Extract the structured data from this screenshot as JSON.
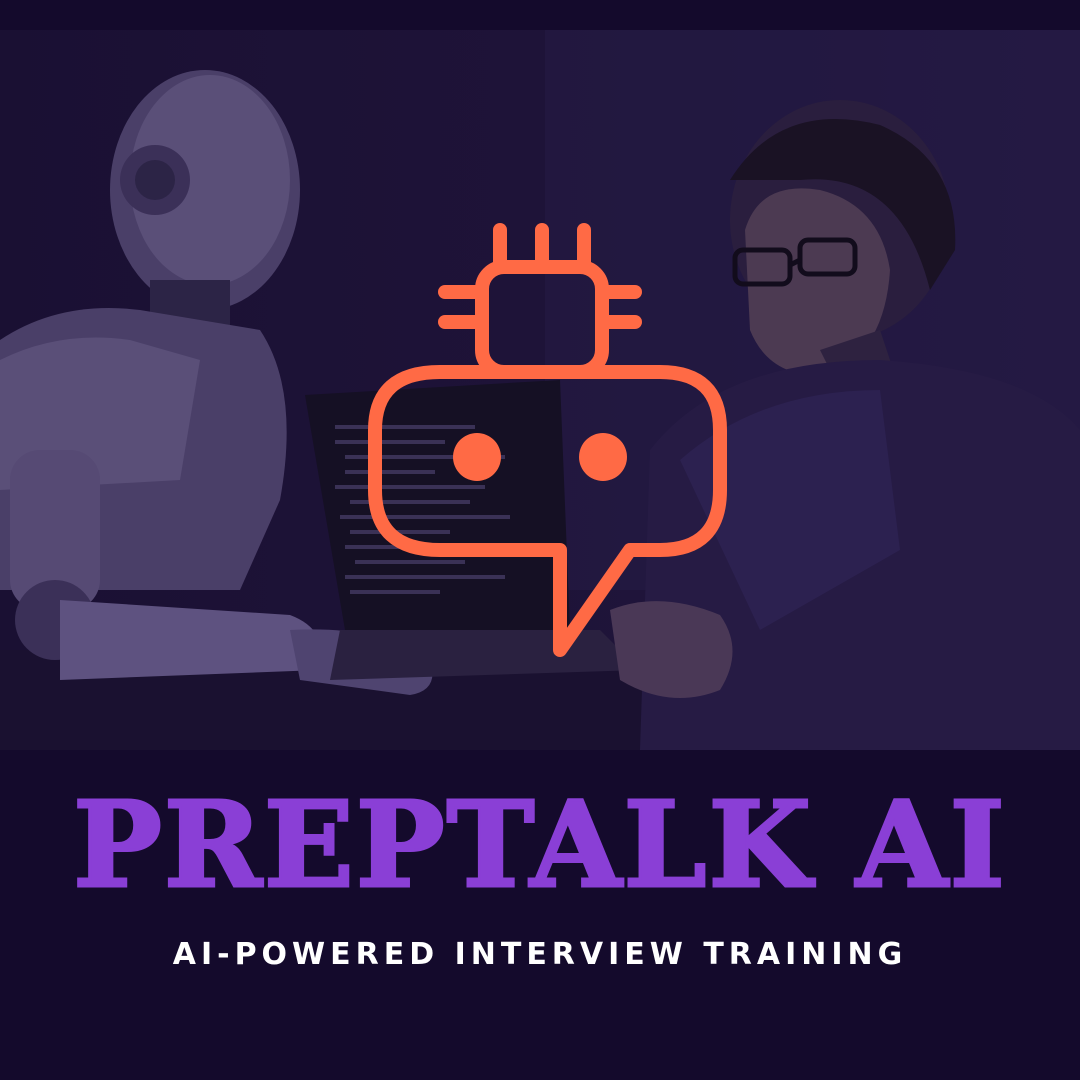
{
  "brand": {
    "title": "PREPTALK AI",
    "subtitle": "AI-POWERED INTERVIEW TRAINING"
  },
  "hero": {
    "logo_icon": "robot-chat-bubble-icon",
    "scene": "robot-and-man-interview-photo"
  },
  "colors": {
    "background": "#140a2c",
    "title": "#8a3fd6",
    "subtitle": "#ffffff",
    "logo": "#ff6a45"
  }
}
